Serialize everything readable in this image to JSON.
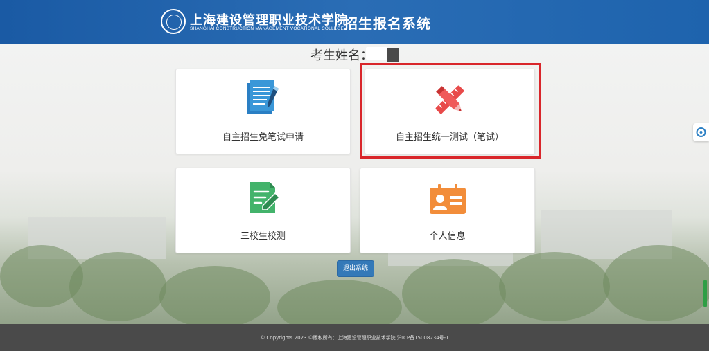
{
  "header": {
    "college_name_cn": "上海建设管理职业技术学院",
    "college_name_en": "SHANGHAI CONSTRUCTION MANAGEMENT VOCATIONAL COLLEGE",
    "system_title": "招生报名系统"
  },
  "student": {
    "name_label": "考生姓名："
  },
  "menu": {
    "items": [
      {
        "label": "自主招生免笔试申请",
        "icon": "document-pen-icon"
      },
      {
        "label": "自主招生统一测试（笔试）",
        "icon": "pencil-ruler-icon"
      },
      {
        "label": "三校生校测",
        "icon": "edit-document-icon"
      },
      {
        "label": "个人信息",
        "icon": "id-card-icon"
      }
    ]
  },
  "actions": {
    "logout_label": "退出系统"
  },
  "footer": {
    "copyright": "© Copyrights 2023 ©版权所有：上海建设管理职业技术学院 沪ICP备15008234号-1"
  },
  "colors": {
    "header_blue": "#1e63ad",
    "highlight_red": "#d9262b",
    "button_blue": "#3479b8",
    "footer_gray": "#4a4a4a"
  }
}
